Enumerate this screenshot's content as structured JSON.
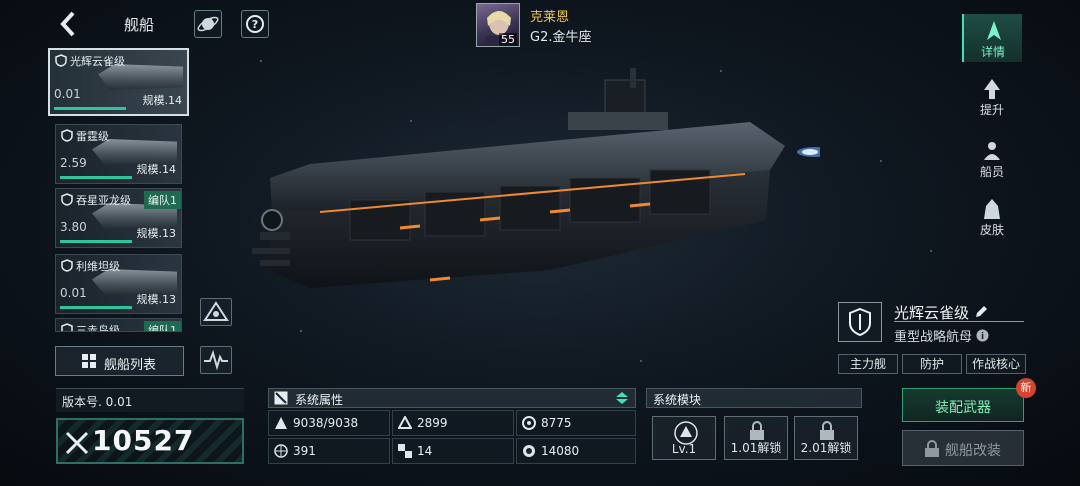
{
  "header": {
    "title": "舰船",
    "player": {
      "name": "克莱恩",
      "level": "55",
      "server": "G2.金牛座"
    }
  },
  "ship_list": [
    {
      "name": "光辉云雀级",
      "value": "0.01",
      "scale": "规模.14",
      "fleet": "",
      "selected": true
    },
    {
      "name": "雷霆级",
      "value": "2.59",
      "scale": "规模.14",
      "fleet": "",
      "selected": false
    },
    {
      "name": "吞星亚龙级",
      "value": "3.80",
      "scale": "规模.13",
      "fleet": "编队1",
      "selected": false
    },
    {
      "name": "利维坦级",
      "value": "0.01",
      "scale": "规模.13",
      "fleet": "",
      "selected": false
    },
    {
      "name": "三赤鸟级",
      "value": "",
      "scale": "",
      "fleet": "编队1",
      "selected": false
    }
  ],
  "ship_list_button": "舰船列表",
  "version_label": "版本号. 0.01",
  "power_value": "10527",
  "system_attributes": {
    "title": "系统属性",
    "values": [
      "9038/9038",
      "2899",
      "8775",
      "391",
      "14",
      "14080"
    ]
  },
  "system_modules": {
    "title": "系统模块",
    "slots": [
      "Lv.1",
      "1.01解锁",
      "2.01解锁"
    ]
  },
  "ship_info": {
    "name": "光辉云雀级",
    "type": "重型战略航母",
    "tags": [
      "主力舰",
      "防护",
      "作战核心"
    ]
  },
  "actions": {
    "equip_label": "装配武器",
    "new_badge": "新",
    "modify_label": "舰船改装"
  },
  "nav": [
    {
      "label": "详情",
      "active": true
    },
    {
      "label": "提升",
      "active": false
    },
    {
      "label": "船员",
      "active": false
    },
    {
      "label": "皮肤",
      "active": false
    }
  ],
  "colors": {
    "accent": "#3fe0b3",
    "gold": "#f0c64a",
    "badge": "#d6432f"
  }
}
